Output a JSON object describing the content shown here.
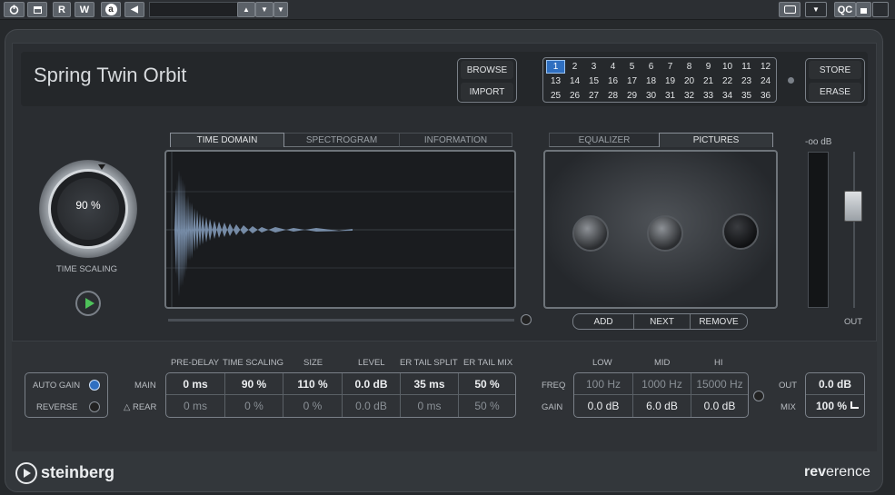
{
  "toolbar": {
    "r": "R",
    "w": "W",
    "a": "a",
    "qc": "QC",
    "preset_value": ""
  },
  "preset": {
    "name": "Spring Twin Orbit",
    "browse": "BROWSE",
    "import": "IMPORT",
    "store": "STORE",
    "erase": "ERASE",
    "selected_slot": 1,
    "slots": [
      "1",
      "2",
      "3",
      "4",
      "5",
      "6",
      "7",
      "8",
      "9",
      "10",
      "11",
      "12",
      "13",
      "14",
      "15",
      "16",
      "17",
      "18",
      "19",
      "20",
      "21",
      "22",
      "23",
      "24",
      "25",
      "26",
      "27",
      "28",
      "29",
      "30",
      "31",
      "32",
      "33",
      "34",
      "35",
      "36"
    ]
  },
  "tabs_left": [
    "TIME DOMAIN",
    "SPECTROGRAM",
    "INFORMATION"
  ],
  "tabs_right": [
    "EQUALIZER",
    "PICTURES"
  ],
  "time_scaling": {
    "value": "90 %",
    "label": "TIME SCALING"
  },
  "picture_buttons": {
    "add": "ADD",
    "next": "NEXT",
    "remove": "REMOVE"
  },
  "meter": {
    "level": "-oo dB",
    "out_label": "OUT"
  },
  "params": {
    "headers": [
      "PRE-DELAY",
      "TIME SCALING",
      "SIZE",
      "LEVEL",
      "ER TAIL SPLIT",
      "ER TAIL MIX"
    ],
    "main_label": "MAIN",
    "rear_label": "REAR",
    "main": [
      "0 ms",
      "90 %",
      "110 %",
      "0.0 dB",
      "35 ms",
      "50 %"
    ],
    "rear": [
      "0 ms",
      "0 %",
      "0 %",
      "0.0 dB",
      "0 ms",
      "50 %"
    ]
  },
  "options": {
    "auto_gain": "AUTO GAIN",
    "reverse": "REVERSE",
    "auto_gain_on": true,
    "reverse_on": false
  },
  "eq": {
    "headers": [
      "LOW",
      "MID",
      "HI"
    ],
    "freq_label": "FREQ",
    "gain_label": "GAIN",
    "freq": [
      "100 Hz",
      "1000 Hz",
      "15000 Hz"
    ],
    "gain": [
      "0.0 dB",
      "6.0 dB",
      "0.0 dB"
    ]
  },
  "output": {
    "out_label": "OUT",
    "mix_label": "MIX",
    "out": "0.0 dB",
    "mix": "100 %"
  },
  "brand": {
    "left": "steinberg",
    "right_a": "rev",
    "right_b": "erence"
  },
  "colors": {
    "accent": "#2f6fc0",
    "waveform": "#7f97b4"
  }
}
